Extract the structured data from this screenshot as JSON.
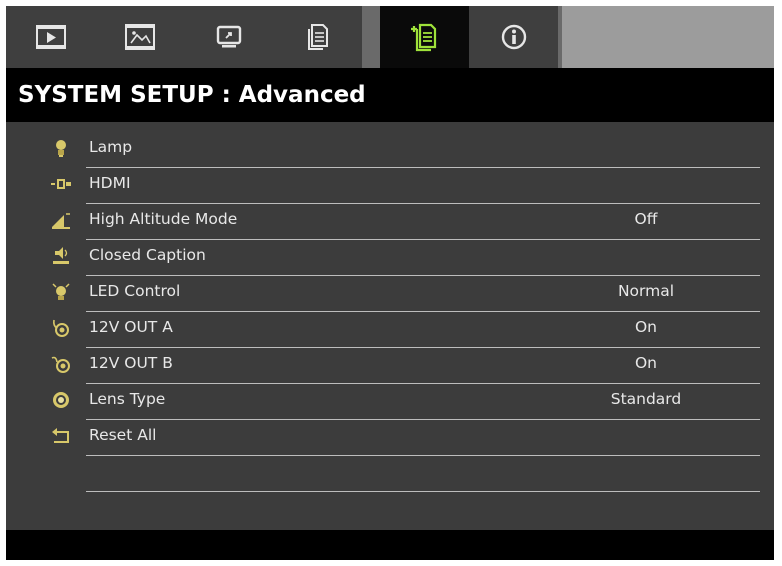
{
  "tabs": [
    {
      "icon": "play-icon",
      "active": false
    },
    {
      "icon": "picture-icon",
      "active": false
    },
    {
      "icon": "display-icon",
      "active": false
    },
    {
      "icon": "document-icon",
      "active": false
    },
    {
      "icon": "system-advanced-icon",
      "active": true
    },
    {
      "icon": "information-icon",
      "active": false
    }
  ],
  "title": "SYSTEM SETUP : Advanced",
  "menu": [
    {
      "label": "Lamp",
      "value": "",
      "icon": "lamp-icon"
    },
    {
      "label": "HDMI",
      "value": "",
      "icon": "hdmi-icon"
    },
    {
      "label": "High Altitude Mode",
      "value": "Off",
      "icon": "altitude-icon"
    },
    {
      "label": "Closed Caption",
      "value": "",
      "icon": "closed-caption-icon"
    },
    {
      "label": "LED Control",
      "value": "Normal",
      "icon": "led-icon"
    },
    {
      "label": "12V OUT A",
      "value": "On",
      "icon": "trigger-a-icon"
    },
    {
      "label": "12V OUT B",
      "value": "On",
      "icon": "trigger-b-icon"
    },
    {
      "label": "Lens Type",
      "value": "Standard",
      "icon": "lens-icon"
    },
    {
      "label": "Reset All",
      "value": "",
      "icon": "reset-icon"
    }
  ],
  "colors": {
    "active_tab_icon": "#9fe23a",
    "inactive_icon": "#e6e6e6",
    "icon_amber": "#d8c86a"
  }
}
